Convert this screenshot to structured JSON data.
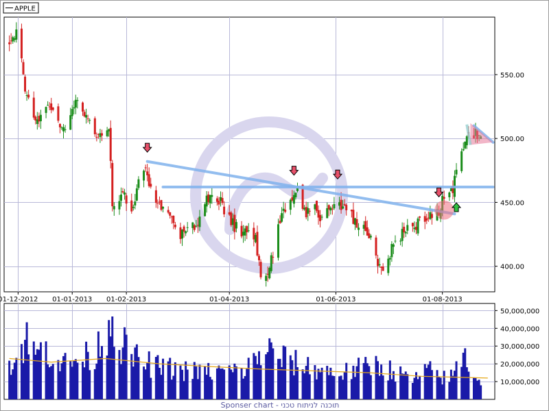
{
  "legend": {
    "label": "APPLE"
  },
  "footer": {
    "text": "Sponser chart - תוכנה לניתוח טכני"
  },
  "colors": {
    "up": "#1a8c1a",
    "down": "#d42020",
    "volume": "#1a1aa8",
    "volume_ma": "#e6a817",
    "trendline": "#7fb2ec",
    "grid": "#b8b8d8",
    "arrow_down": "#e8506a",
    "arrow_up": "#30c040"
  },
  "chart_data": [
    {
      "type": "candlestick",
      "series": [
        {
          "name": "APPLE"
        }
      ],
      "y_ticks": [
        "400.00",
        "450.00",
        "500.00",
        "550.00"
      ],
      "y_tick_values": [
        400,
        450,
        500,
        550
      ],
      "ylim": [
        380,
        595
      ],
      "x_ticks": [
        "01-12-2012",
        "01-01-2013",
        "01-02-2013",
        "01-04-2013",
        "01-06-2013",
        "01-08-2013"
      ],
      "x_tick_dates": [
        "2012-12-01",
        "2013-01-01",
        "2013-02-01",
        "2013-04-01",
        "2013-06-01",
        "2013-08-01"
      ],
      "xlim": [
        "2012-11-23",
        "2013-08-31"
      ],
      "grid": true,
      "legend_position": "top-left",
      "close_path": [
        [
          "2012-11-26",
          575
        ],
        [
          "2012-11-30",
          585
        ],
        [
          "2012-12-05",
          540
        ],
        [
          "2012-12-10",
          520
        ],
        [
          "2012-12-14",
          515
        ],
        [
          "2012-12-19",
          525
        ],
        [
          "2012-12-24",
          515
        ],
        [
          "2012-12-28",
          510
        ],
        [
          "2013-01-04",
          530
        ],
        [
          "2013-01-08",
          520
        ],
        [
          "2013-01-14",
          505
        ],
        [
          "2013-01-18",
          500
        ],
        [
          "2013-01-22",
          505
        ],
        [
          "2013-01-24",
          450
        ],
        [
          "2013-01-30",
          455
        ],
        [
          "2013-02-05",
          445
        ],
        [
          "2013-02-08",
          465
        ],
        [
          "2013-02-12",
          475
        ],
        [
          "2013-02-15",
          460
        ],
        [
          "2013-02-20",
          445
        ],
        [
          "2013-02-26",
          440
        ],
        [
          "2013-03-04",
          425
        ],
        [
          "2013-03-08",
          430
        ],
        [
          "2013-03-14",
          435
        ],
        [
          "2013-03-18",
          450
        ],
        [
          "2013-03-22",
          460
        ],
        [
          "2013-03-27",
          450
        ],
        [
          "2013-04-02",
          435
        ],
        [
          "2013-04-08",
          425
        ],
        [
          "2013-04-12",
          430
        ],
        [
          "2013-04-16",
          420
        ],
        [
          "2013-04-19",
          390
        ],
        [
          "2013-04-23",
          395
        ],
        [
          "2013-04-26",
          410
        ],
        [
          "2013-05-01",
          440
        ],
        [
          "2013-05-06",
          455
        ],
        [
          "2013-05-10",
          460
        ],
        [
          "2013-05-15",
          440
        ],
        [
          "2013-05-20",
          445
        ],
        [
          "2013-05-24",
          438
        ],
        [
          "2013-05-30",
          445
        ],
        [
          "2013-06-04",
          448
        ],
        [
          "2013-06-10",
          440
        ],
        [
          "2013-06-14",
          432
        ],
        [
          "2013-06-20",
          425
        ],
        [
          "2013-06-24",
          405
        ],
        [
          "2013-06-28",
          395
        ],
        [
          "2013-07-03",
          415
        ],
        [
          "2013-07-09",
          425
        ],
        [
          "2013-07-15",
          430
        ],
        [
          "2013-07-19",
          435
        ],
        [
          "2013-07-24",
          440
        ],
        [
          "2013-07-29",
          440
        ],
        [
          "2013-08-02",
          455
        ],
        [
          "2013-08-07",
          462
        ],
        [
          "2013-08-12",
          490
        ],
        [
          "2013-08-15",
          500
        ],
        [
          "2013-08-20",
          505
        ],
        [
          "2013-08-23",
          502
        ]
      ],
      "annotations": {
        "trendlines": [
          {
            "from": [
              "2013-02-13",
              482
            ],
            "to": [
              "2013-08-08",
              441
            ]
          },
          {
            "from": [
              "2013-02-22",
              462
            ],
            "to": [
              "2013-08-30",
              462
            ]
          },
          {
            "from": [
              "2013-08-19",
              510
            ],
            "to": [
              "2013-08-30",
              497
            ]
          }
        ],
        "sell_arrows": [
          [
            "2013-02-13",
            492
          ],
          [
            "2013-05-08",
            474
          ],
          [
            "2013-06-02",
            471
          ],
          [
            "2013-07-30",
            457
          ]
        ],
        "buy_arrows": [
          [
            "2013-08-09",
            447
          ]
        ]
      }
    },
    {
      "type": "bar",
      "series": [],
      "y_ticks": [
        "10,000,000",
        "20,000,000",
        "30,000,000",
        "40,000,000",
        "50,000,000"
      ],
      "y_tick_values": [
        10000000,
        20000000,
        30000000,
        40000000,
        50000000
      ],
      "ylim": [
        0,
        54000000
      ],
      "grid": true,
      "volume_path": [
        [
          "2012-11-26",
          21000000
        ],
        [
          "2012-11-30",
          24000000
        ],
        [
          "2012-12-06",
          40000000
        ],
        [
          "2012-12-10",
          28000000
        ],
        [
          "2012-12-17",
          32000000
        ],
        [
          "2012-12-28",
          22000000
        ],
        [
          "2013-01-14",
          28000000
        ],
        [
          "2013-01-24",
          52000000
        ],
        [
          "2013-01-28",
          36000000
        ],
        [
          "2013-02-08",
          24000000
        ],
        [
          "2013-02-20",
          20000000
        ],
        [
          "2013-03-15",
          17000000
        ],
        [
          "2013-04-10",
          18000000
        ],
        [
          "2013-04-22",
          32000000
        ],
        [
          "2013-04-26",
          28000000
        ],
        [
          "2013-05-10",
          22000000
        ],
        [
          "2013-06-03",
          16000000
        ],
        [
          "2013-06-25",
          22000000
        ],
        [
          "2013-07-15",
          12000000
        ],
        [
          "2013-07-24",
          18000000
        ],
        [
          "2013-08-05",
          12000000
        ],
        [
          "2013-08-13",
          28000000
        ],
        [
          "2013-08-22",
          12000000
        ],
        [
          "2013-08-27",
          8000000
        ]
      ],
      "ma_path": [
        [
          "2012-11-26",
          23000000
        ],
        [
          "2012-12-20",
          21000000
        ],
        [
          "2013-01-20",
          23000000
        ],
        [
          "2013-02-20",
          20000000
        ],
        [
          "2013-03-20",
          18500000
        ],
        [
          "2013-04-20",
          17000000
        ],
        [
          "2013-05-20",
          16000000
        ],
        [
          "2013-06-20",
          15000000
        ],
        [
          "2013-07-20",
          13000000
        ],
        [
          "2013-08-27",
          12000000
        ]
      ]
    }
  ]
}
